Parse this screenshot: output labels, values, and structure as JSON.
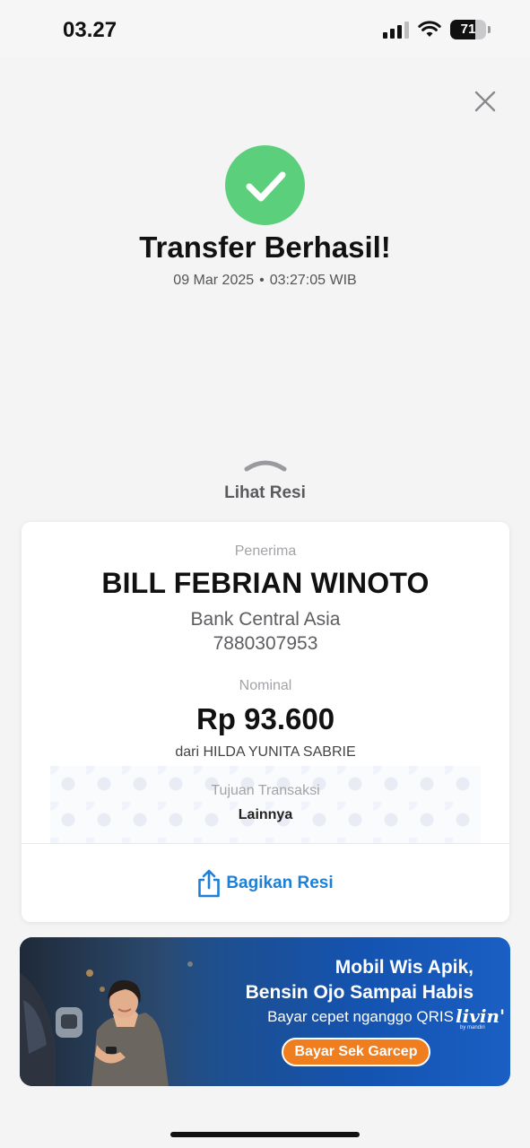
{
  "status_bar": {
    "time": "03.27",
    "battery_level": "71",
    "icons": [
      "cellular-signal-icon",
      "wifi-icon",
      "battery-icon"
    ]
  },
  "header": {
    "close_icon": "close-icon",
    "success_icon": "check-circle-icon",
    "title": "Transfer Berhasil!",
    "date": "09 Mar 2025",
    "separator": "•",
    "time": "03:27:05 WIB"
  },
  "receipt_toggle": {
    "icon": "chevron-up-icon",
    "label": "Lihat Resi"
  },
  "receipt": {
    "receiver_label": "Penerima",
    "receiver_name": "BILL FEBRIAN WINOTO",
    "receiver_bank": "Bank Central Asia",
    "receiver_account": "7880307953",
    "nominal_label": "Nominal",
    "amount": "Rp 93.600",
    "sender": "dari HILDA YUNITA SABRIE",
    "purpose_label": "Tujuan Transaksi",
    "purpose_value": "Lainnya",
    "share_icon": "share-icon",
    "share_label": "Bagikan Resi"
  },
  "promo": {
    "line1": "Mobil Wis Apik,",
    "line2": "Bensin Ojo Sampai Habis",
    "line3": "Bayar cepet nganggo QRIS",
    "brand": "livin'",
    "brand_sub": "by mandiri",
    "cta": "Bayar Sek Garcep"
  },
  "colors": {
    "success": "#5ccf7c",
    "accent_blue": "#1d7fd6",
    "cta_orange": "#f07d1e",
    "banner_blue": "#1453b0"
  }
}
